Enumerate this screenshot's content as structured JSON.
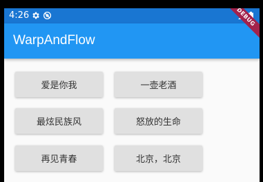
{
  "status_bar": {
    "time": "4:26",
    "icons": [
      "gear-icon",
      "dnd-icon",
      "wifi-icon",
      "battery-icon"
    ]
  },
  "debug_banner": "DEBUG",
  "app_bar": {
    "title": "WarpAndFlow"
  },
  "buttons": [
    "爱是你我",
    "一壶老酒",
    "最炫民族风",
    "怒放的生命",
    "再见青春",
    "北京，北京"
  ],
  "colors": {
    "status_bar": "#1976d2",
    "app_bar": "#2196f3",
    "button": "#e0e0e0",
    "background": "#fafafa",
    "debug_banner": "#a3224b"
  }
}
